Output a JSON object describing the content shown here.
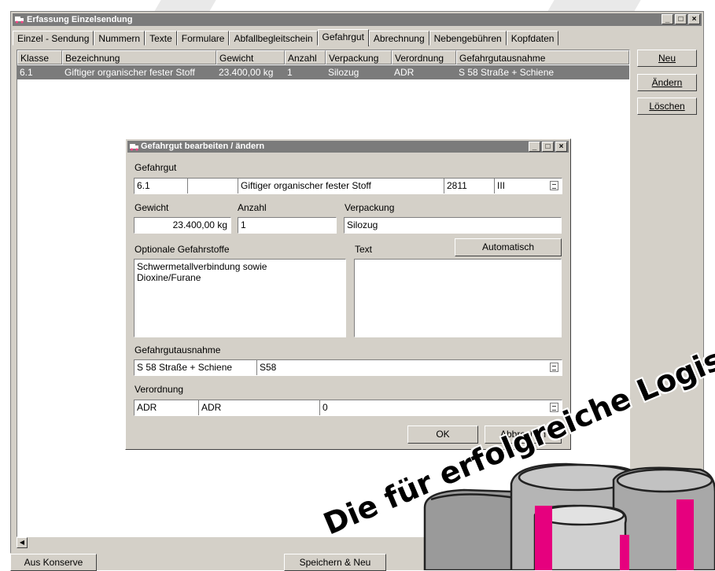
{
  "window": {
    "title": "Erfassung Einzelsendung",
    "controls": [
      "_",
      "□",
      "×"
    ]
  },
  "tabs": [
    {
      "label": "Einzel - Sendung"
    },
    {
      "label": "Nummern"
    },
    {
      "label": "Texte"
    },
    {
      "label": "Formulare"
    },
    {
      "label": "Abfallbegleitschein"
    },
    {
      "label": "Gefahrgut",
      "active": true
    },
    {
      "label": "Abrechnung"
    },
    {
      "label": "Nebengebühren"
    },
    {
      "label": "Kopfdaten"
    }
  ],
  "table": {
    "columns": [
      "Klasse",
      "Bezeichnung",
      "Gewicht",
      "Anzahl",
      "Verpackung",
      "Verordnung",
      "Gefahrgutausnahme"
    ],
    "rows": [
      [
        "6.1",
        "Giftiger organischer fester Stoff",
        "23.400,00 kg",
        "1",
        "Silozug",
        "ADR",
        "S 58  Straße + Schiene"
      ]
    ]
  },
  "side_buttons": {
    "new": "Neu",
    "edit": "Ändern",
    "delete": "Löschen"
  },
  "bottom_buttons": {
    "aus_konserve": "Aus Konserve",
    "speichern_neu": "Speichern & Neu"
  },
  "dialog": {
    "title": "Gefahrgut bearbeiten / ändern",
    "gefahrgut_label": "Gefahrgut",
    "gefahrgut": {
      "klasse": "6.1",
      "ziffer": "",
      "bezeichnung": "Giftiger organischer fester Stoff",
      "un_nummer": "2811",
      "verpackungsgruppe": "III"
    },
    "gewicht_label": "Gewicht",
    "gewicht": "23.400,00 kg",
    "anzahl_label": "Anzahl",
    "anzahl": "1",
    "verpackung_label": "Verpackung",
    "verpackung": "Silozug",
    "optionale_label": "Optionale Gefahrstoffe",
    "optionale": "Schwermetallverbindung sowie\nDioxine/Furane",
    "text_label": "Text",
    "text": "",
    "automatisch_button": "Automatisch",
    "ausnahme_label": "Gefahrgutausnahme",
    "ausnahme": {
      "name": "S 58 Straße + Schiene",
      "code": "S58"
    },
    "verordnung_label": "Verordnung",
    "verordnung": {
      "code": "ADR",
      "name": "ADR",
      "wert": "0"
    },
    "ok_button": "OK",
    "cancel_button": "Abbrechen"
  },
  "slogan": "Die für erfolgreiche Logistiker!",
  "colors": {
    "magenta": "#e6007e",
    "titlebar": "#7b7b7b",
    "face": "#d4d0c8"
  }
}
